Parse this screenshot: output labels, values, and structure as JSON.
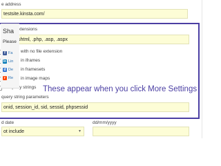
{
  "form": {
    "site_url_label": "e address",
    "site_url_value": "testsite.kinsta.com/",
    "exclude_all_ext_label": "ude all extensions",
    "extensions_value": ".html, .shtml, .php, .asp, .aspx",
    "options": [
      "ude urls with no file extension",
      "ude urls in iframes",
      "ude urls in framesets",
      "ude urls in image maps",
      "ow query strings"
    ],
    "query_params_label": "query string parameters",
    "query_params_value": "onid, session_id, sid, sessid, phpsessid",
    "date_label": "d date",
    "date_placeholder": "dd/mm/yyyy",
    "include_value": "ot include"
  },
  "annotation": "These appear when you click More Settings",
  "sidebar": {
    "title": "Sha",
    "please": "Please",
    "shares": [
      {
        "abbr": "Fa",
        "icon": "facebook-icon",
        "color": "#3b5998"
      },
      {
        "abbr": "Lin",
        "icon": "linkedin-icon",
        "color": "#0077b5"
      },
      {
        "abbr": "De",
        "icon": "delicious-icon",
        "color": "#3274d1"
      },
      {
        "abbr": "Re",
        "icon": "reddit-icon",
        "color": "#ff4500"
      }
    ]
  }
}
